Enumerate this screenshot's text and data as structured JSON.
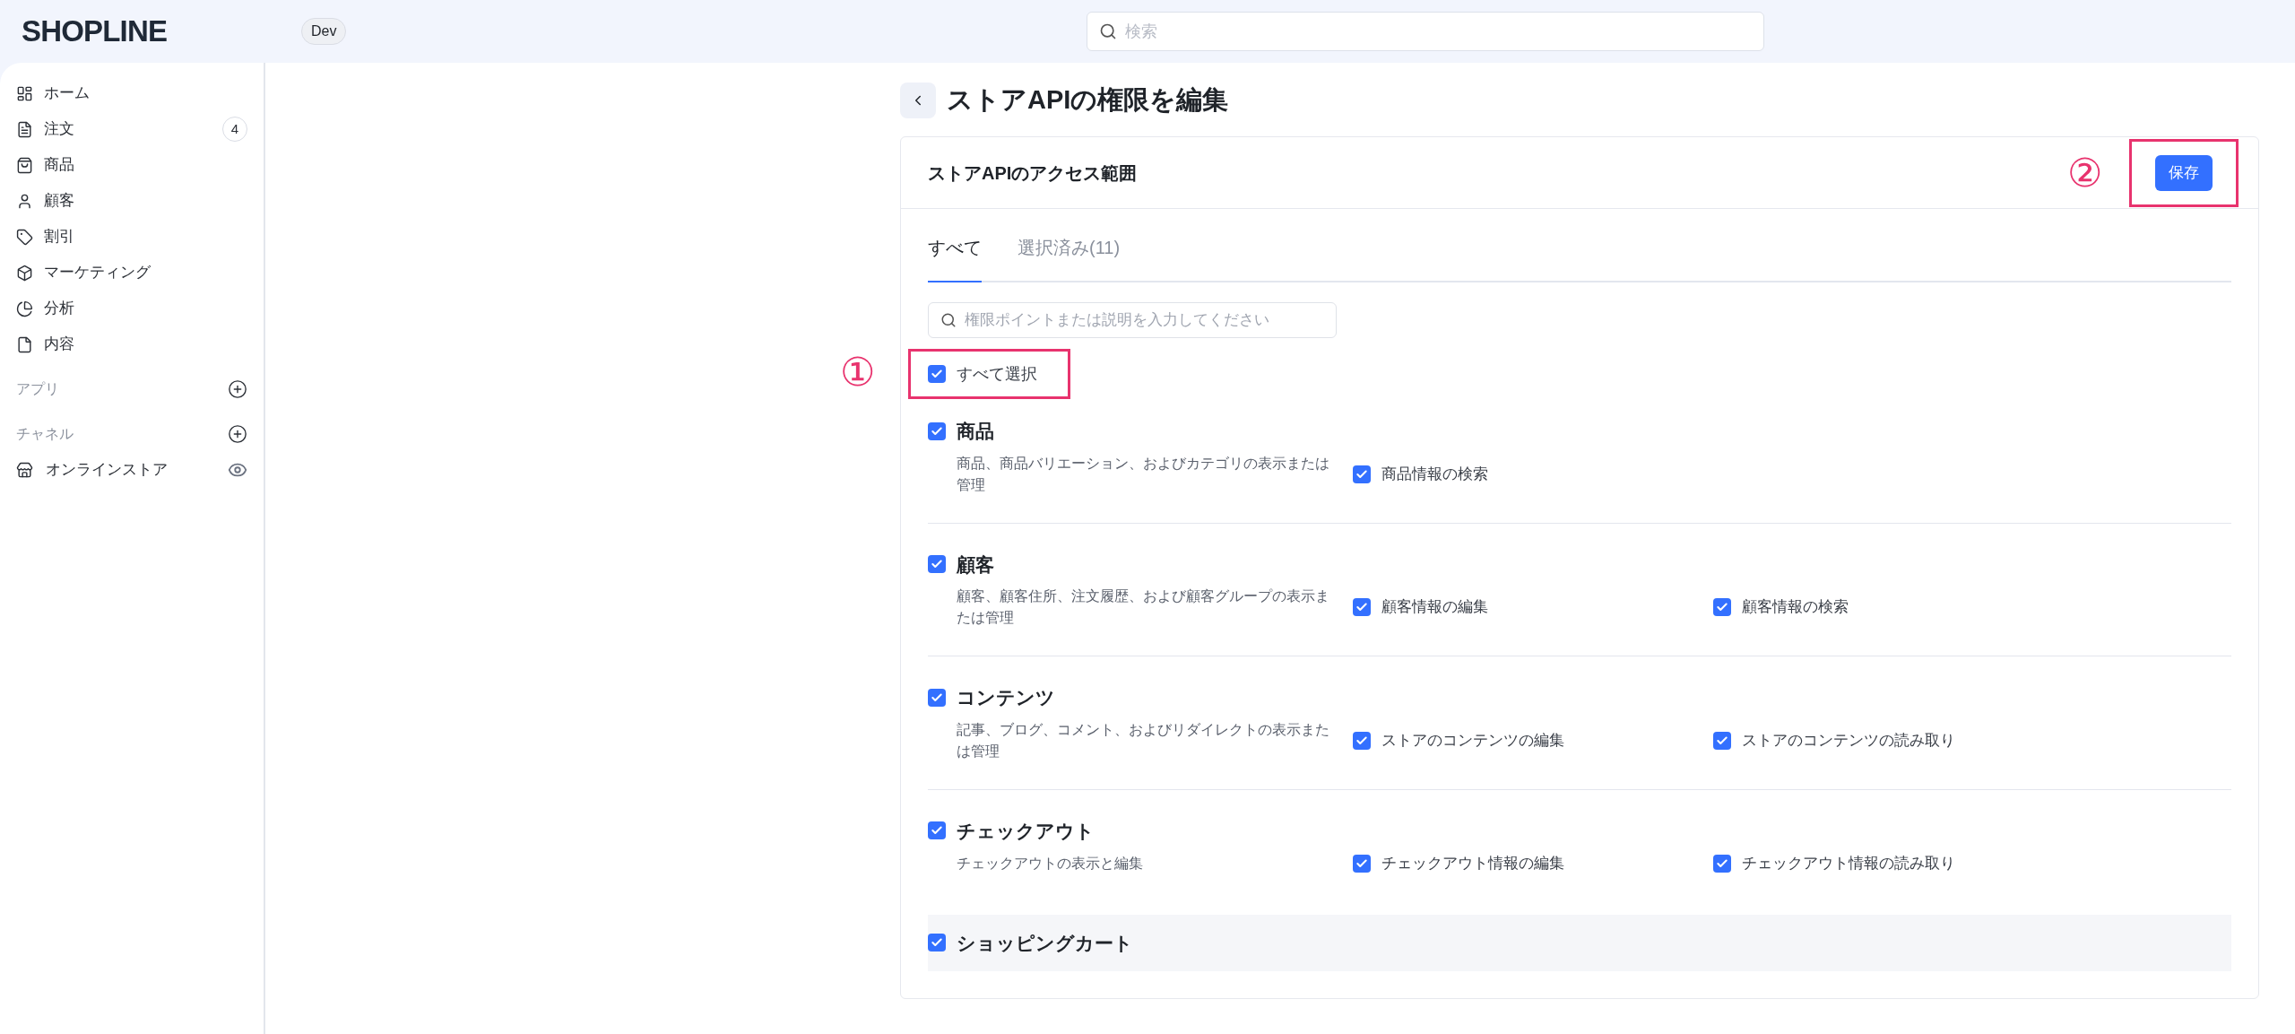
{
  "topbar": {
    "logo": "SHOPLINE",
    "env_badge": "Dev",
    "search": {
      "placeholder": "検索"
    }
  },
  "sidebar": {
    "items": [
      {
        "label": "ホーム"
      },
      {
        "label": "注文",
        "badge": "4"
      },
      {
        "label": "商品"
      },
      {
        "label": "顧客"
      },
      {
        "label": "割引"
      },
      {
        "label": "マーケティング"
      },
      {
        "label": "分析"
      },
      {
        "label": "内容"
      }
    ],
    "groups": [
      {
        "label": "アプリ"
      },
      {
        "label": "チャネル",
        "items": [
          {
            "label": "オンラインストア"
          }
        ]
      }
    ]
  },
  "page": {
    "title": "ストアAPIの権限を編集",
    "card": {
      "title": "ストアAPIのアクセス範囲",
      "save_button": "保存",
      "save_annotation": "②",
      "tabs": [
        {
          "label": "すべて",
          "selected": true
        },
        {
          "label": "選択済み(11)",
          "selected": false
        }
      ],
      "search": {
        "placeholder": "権限ポイントまたは説明を入力してください"
      },
      "select_all": {
        "label": "すべて選択",
        "checked": true,
        "annotation": "①"
      },
      "sections": [
        {
          "title": "商品",
          "checked": true,
          "highlighted": false,
          "description": "商品、商品バリエーション、およびカテゴリの表示または管理",
          "permissions": [
            {
              "label": "商品情報の検索",
              "checked": true
            }
          ]
        },
        {
          "title": "顧客",
          "checked": true,
          "highlighted": false,
          "description": "顧客、顧客住所、注文履歴、および顧客グループの表示または管理",
          "permissions": [
            {
              "label": "顧客情報の編集",
              "checked": true
            },
            {
              "label": "顧客情報の検索",
              "checked": true
            }
          ]
        },
        {
          "title": "コンテンツ",
          "checked": true,
          "highlighted": false,
          "description": "記事、ブログ、コメント、およびリダイレクトの表示または管理",
          "permissions": [
            {
              "label": "ストアのコンテンツの編集",
              "checked": true
            },
            {
              "label": "ストアのコンテンツの読み取り",
              "checked": true
            }
          ]
        },
        {
          "title": "チェックアウト",
          "checked": true,
          "highlighted": false,
          "description": "チェックアウトの表示と編集",
          "permissions": [
            {
              "label": "チェックアウト情報の編集",
              "checked": true
            },
            {
              "label": "チェックアウト情報の読み取り",
              "checked": true
            }
          ]
        },
        {
          "title": "ショッピングカート",
          "checked": true,
          "highlighted": true
        }
      ]
    }
  }
}
